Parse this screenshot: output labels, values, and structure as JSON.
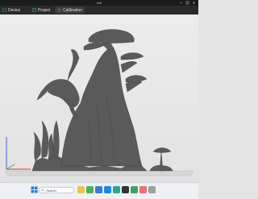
{
  "window": {
    "title": "cbfr"
  },
  "tabs": [
    {
      "label": "Device",
      "icon": "device-icon",
      "active": false
    },
    {
      "label": "Project",
      "icon": "project-icon",
      "active": false
    },
    {
      "label": "Calibration",
      "icon": "calibration-icon",
      "active": true
    }
  ],
  "viewport": {
    "model": "3D model of a panther on a tree trunk with flat-canopy trees",
    "axes": [
      "x-axis",
      "y-axis",
      "z-axis"
    ]
  },
  "taskbar": {
    "search_placeholder": "Search",
    "apps": [
      "file-explorer-icon",
      "browser-icon",
      "store-icon",
      "mail-icon",
      "edge-icon",
      "terminal-icon",
      "slicer-icon",
      "photos-icon",
      "settings-icon"
    ],
    "time": "",
    "date": ""
  },
  "colors": {
    "titlebar": "#1b1b1b",
    "tabbar": "#2a2a2c",
    "accent": "#3aa55a",
    "model": "#555555"
  }
}
